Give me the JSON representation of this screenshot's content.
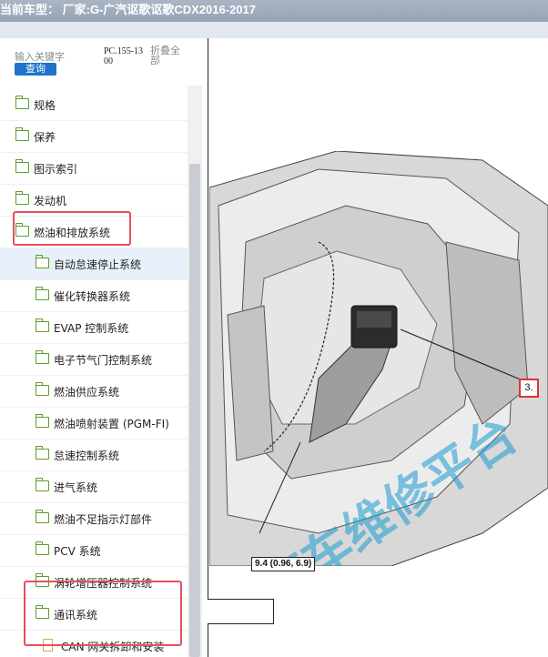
{
  "window": {
    "title": "当前车型： 厂家:G-广汽讴歌讴歌CDX2016-2017"
  },
  "search": {
    "placeholder": "输入关键字",
    "query_button": "查询",
    "code": "PC.155-1300",
    "collapse_all": "折叠全部"
  },
  "tree": {
    "items": [
      {
        "label": "规格"
      },
      {
        "label": "保养"
      },
      {
        "label": "图示索引"
      },
      {
        "label": "发动机"
      },
      {
        "label": "燃油和排放系统"
      },
      {
        "label": "自动怠速停止系统"
      },
      {
        "label": "催化转换器系统"
      },
      {
        "label": "EVAP 控制系统"
      },
      {
        "label": "电子节气门控制系统"
      },
      {
        "label": "燃油供应系统"
      },
      {
        "label": "燃油喷射装置 (PGM-FI)"
      },
      {
        "label": "怠速控制系统"
      },
      {
        "label": "进气系统"
      },
      {
        "label": "燃油不足指示灯部件"
      },
      {
        "label": "PCV 系统"
      },
      {
        "label": "涡轮增压器控制系统"
      },
      {
        "label": "通讯系统"
      },
      {
        "label": "CAN 网关拆卸和安装"
      }
    ]
  },
  "diagram": {
    "callout": "3.",
    "torque_spec": "9.4 (0.96, 6.9)",
    "watermark": "汽车维修平台"
  },
  "colors": {
    "folder_icon": "#5aa02c",
    "doc_icon": "#e0a64c",
    "highlight": "#e2505f",
    "button": "#1f74c9"
  }
}
